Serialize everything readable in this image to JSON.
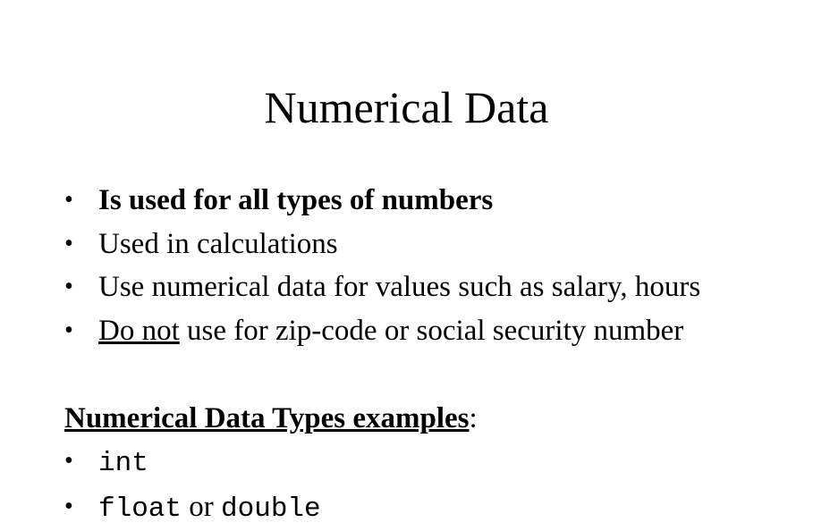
{
  "slide": {
    "title": "Numerical Data",
    "bullet_glyph": "•",
    "bullets": [
      {
        "text": "Is used for all types of numbers"
      },
      {
        "text": "Used in calculations"
      },
      {
        "text": "Use numerical data for values such as salary, hours"
      },
      {
        "underlined": "Do not",
        "rest": " use for zip-code or social security number"
      }
    ],
    "subheading": {
      "text": "Numerical Data Types examples",
      "suffix": ":"
    },
    "types": [
      {
        "code": "int"
      },
      {
        "code": "float",
        "joiner": " or ",
        "code2": "double"
      }
    ]
  }
}
